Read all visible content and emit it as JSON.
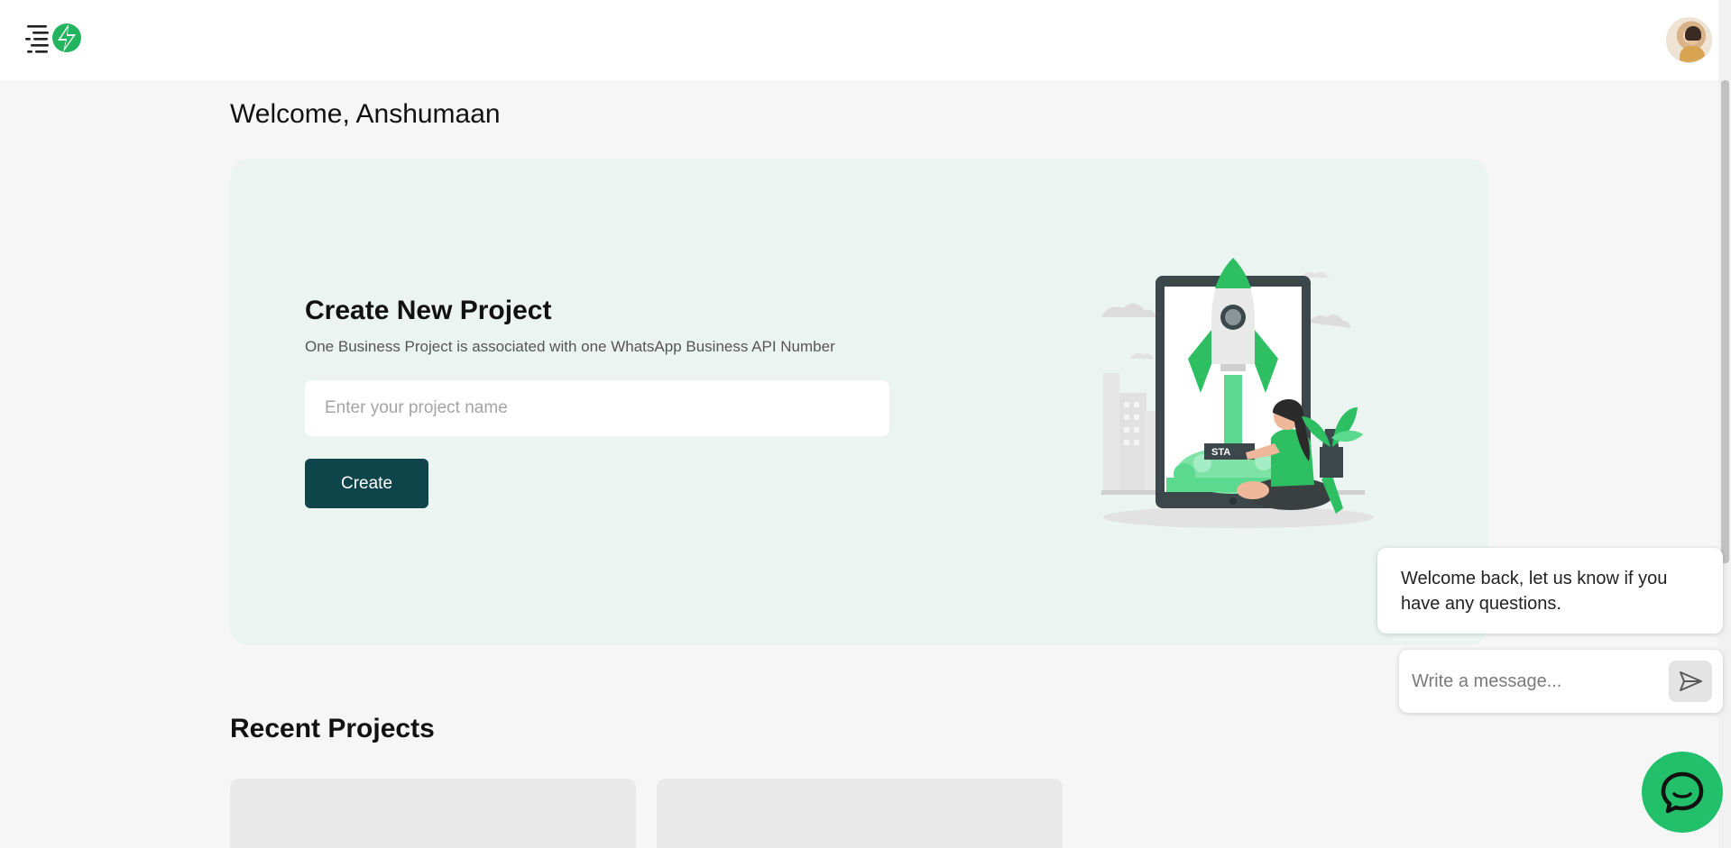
{
  "header": {
    "logo_icon": "lightning-menu-logo",
    "avatar_icon": "user-avatar"
  },
  "welcome": {
    "title": "Welcome, Anshumaan"
  },
  "create_project": {
    "title": "Create New Project",
    "subtitle": "One Business Project is associated with one WhatsApp Business API Number",
    "input_placeholder": "Enter your project name",
    "input_value": "",
    "button_label": "Create",
    "illustration_label": "STA"
  },
  "recent_projects": {
    "title": "Recent Projects",
    "cards": [
      {
        "label": ""
      },
      {
        "label": ""
      }
    ]
  },
  "chat_widget": {
    "welcome_message": "Welcome back, let us know if you have any questions.",
    "input_placeholder": "Write a message...",
    "send_icon": "send-icon",
    "launcher_icon": "chat-bubble-icon"
  },
  "colors": {
    "accent": "#0e454b",
    "brand_green": "#22c06b",
    "hero_bg": "#ebf4f1",
    "page_bg": "#f6f6f6"
  }
}
